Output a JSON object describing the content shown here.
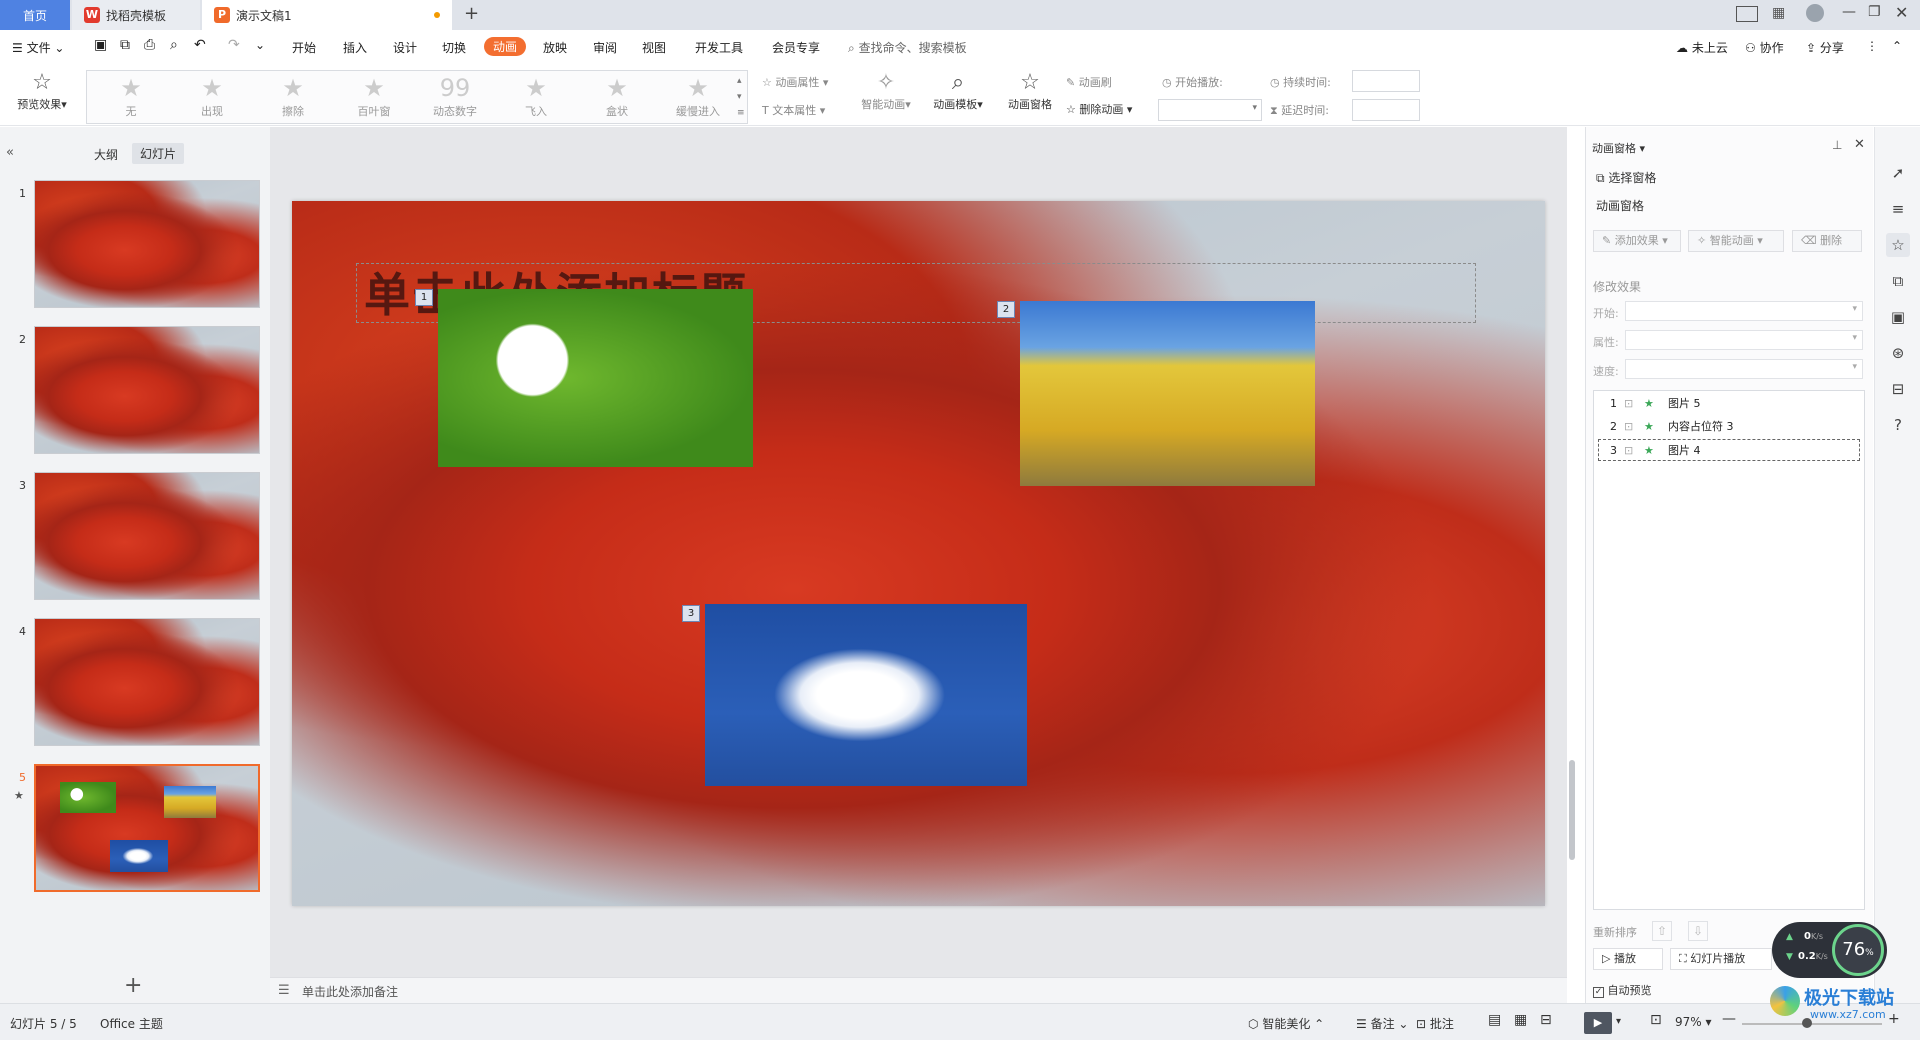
{
  "titlebar": {
    "tabs": [
      {
        "label": "首页"
      },
      {
        "label": "找稻壳模板"
      },
      {
        "label": "演示文稿1"
      }
    ],
    "new_tab": "+"
  },
  "menubar": {
    "file": "文件",
    "items": [
      "开始",
      "插入",
      "设计",
      "切换",
      "动画",
      "放映",
      "审阅",
      "视图",
      "开发工具",
      "会员专享"
    ],
    "active": "动画",
    "search": "查找命令、搜索模板",
    "right": [
      "未上云",
      "协作",
      "分享"
    ]
  },
  "ribbon": {
    "preview": "预览效果",
    "gallery": [
      "无",
      "出现",
      "擦除",
      "百叶窗",
      "动态数字",
      "飞入",
      "盒状",
      "缓慢进入"
    ],
    "anim_attr": "动画属性",
    "text_attr": "文本属性",
    "smart_anim": "智能动画",
    "anim_template": "动画模板",
    "anim_pane": "动画窗格",
    "anim_brush": "动画刷",
    "delete_anim": "删除动画",
    "start_play": "开始播放:",
    "duration": "持续时间:",
    "delay": "延迟时间:"
  },
  "leftpanel": {
    "tabs": [
      "大纲",
      "幻灯片"
    ],
    "active_tab": "幻灯片",
    "slides": [
      "1",
      "2",
      "3",
      "4",
      "5"
    ],
    "add": "+"
  },
  "slide": {
    "title_placeholder": "单击此处添加标题",
    "tags": [
      "1",
      "2",
      "3"
    ]
  },
  "notes": {
    "placeholder": "单击此处添加备注"
  },
  "animpane": {
    "header": "动画窗格",
    "select_pane": "选择窗格",
    "section": "动画窗格",
    "add_effect": "添加效果",
    "smart_anim": "智能动画",
    "delete": "删除",
    "modify": "修改效果",
    "start_label": "开始:",
    "attr_label": "属性:",
    "speed_label": "速度:",
    "items": [
      {
        "num": "1",
        "name": "图片 5"
      },
      {
        "num": "2",
        "name": "内容占位符 3"
      },
      {
        "num": "3",
        "name": "图片 4"
      }
    ],
    "reorder": "重新排序",
    "play": "播放",
    "slideshow": "幻灯片播放",
    "auto_preview": "自动预览"
  },
  "speedwidget": {
    "up": "0",
    "up_unit": "K/s",
    "down": "0.2",
    "down_unit": "K/s",
    "percent": "76"
  },
  "statusbar": {
    "slide_count": "幻灯片 5 / 5",
    "theme": "Office 主题",
    "smart_beautify": "智能美化",
    "notes": "备注",
    "comments": "批注",
    "zoom": "97%"
  },
  "watermark": {
    "title": "极光下载站",
    "url": "www.xz7.com"
  }
}
